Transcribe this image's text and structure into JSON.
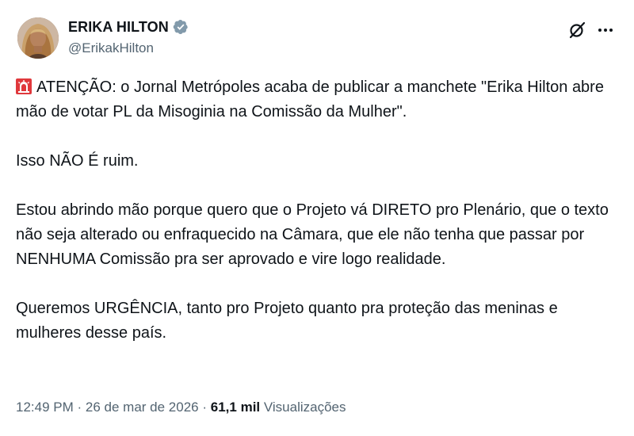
{
  "author": {
    "display_name": "ERIKA HILTON",
    "handle": "@ErikakHilton",
    "verified_icon": "verified-badge-icon",
    "avatar_icon": "profile-photo"
  },
  "actions": {
    "grok_icon": "grok-icon",
    "more_icon": "more-options-icon"
  },
  "post": {
    "siren_icon": "police-light-emoji",
    "paragraphs": [
      "ATENÇÃO: o Jornal Metrópoles acaba de publicar a manchete \"Erika Hilton abre mão de votar PL da Misoginia na Comissão da Mulher\".",
      "Isso NÃO É ruim.",
      "Estou abrindo mão porque quero que o Projeto vá DIRETO pro Plenário, que o texto não seja alterado ou enfraquecido na Câmara, que ele não tenha que passar por NENHUMA Comissão pra ser aprovado e vire logo realidade.",
      "Queremos URGÊNCIA, tanto pro Projeto quanto pra proteção das meninas e mulheres desse país."
    ]
  },
  "meta": {
    "time": "12:49 PM",
    "separator": "·",
    "date": "26 de mar de 2026",
    "views_count": "61,1 mil",
    "views_label": "Visualizações"
  },
  "colors": {
    "text_primary": "#0f1419",
    "text_secondary": "#536471",
    "verified_badge": "#829aab",
    "siren_red": "#e0383c"
  }
}
